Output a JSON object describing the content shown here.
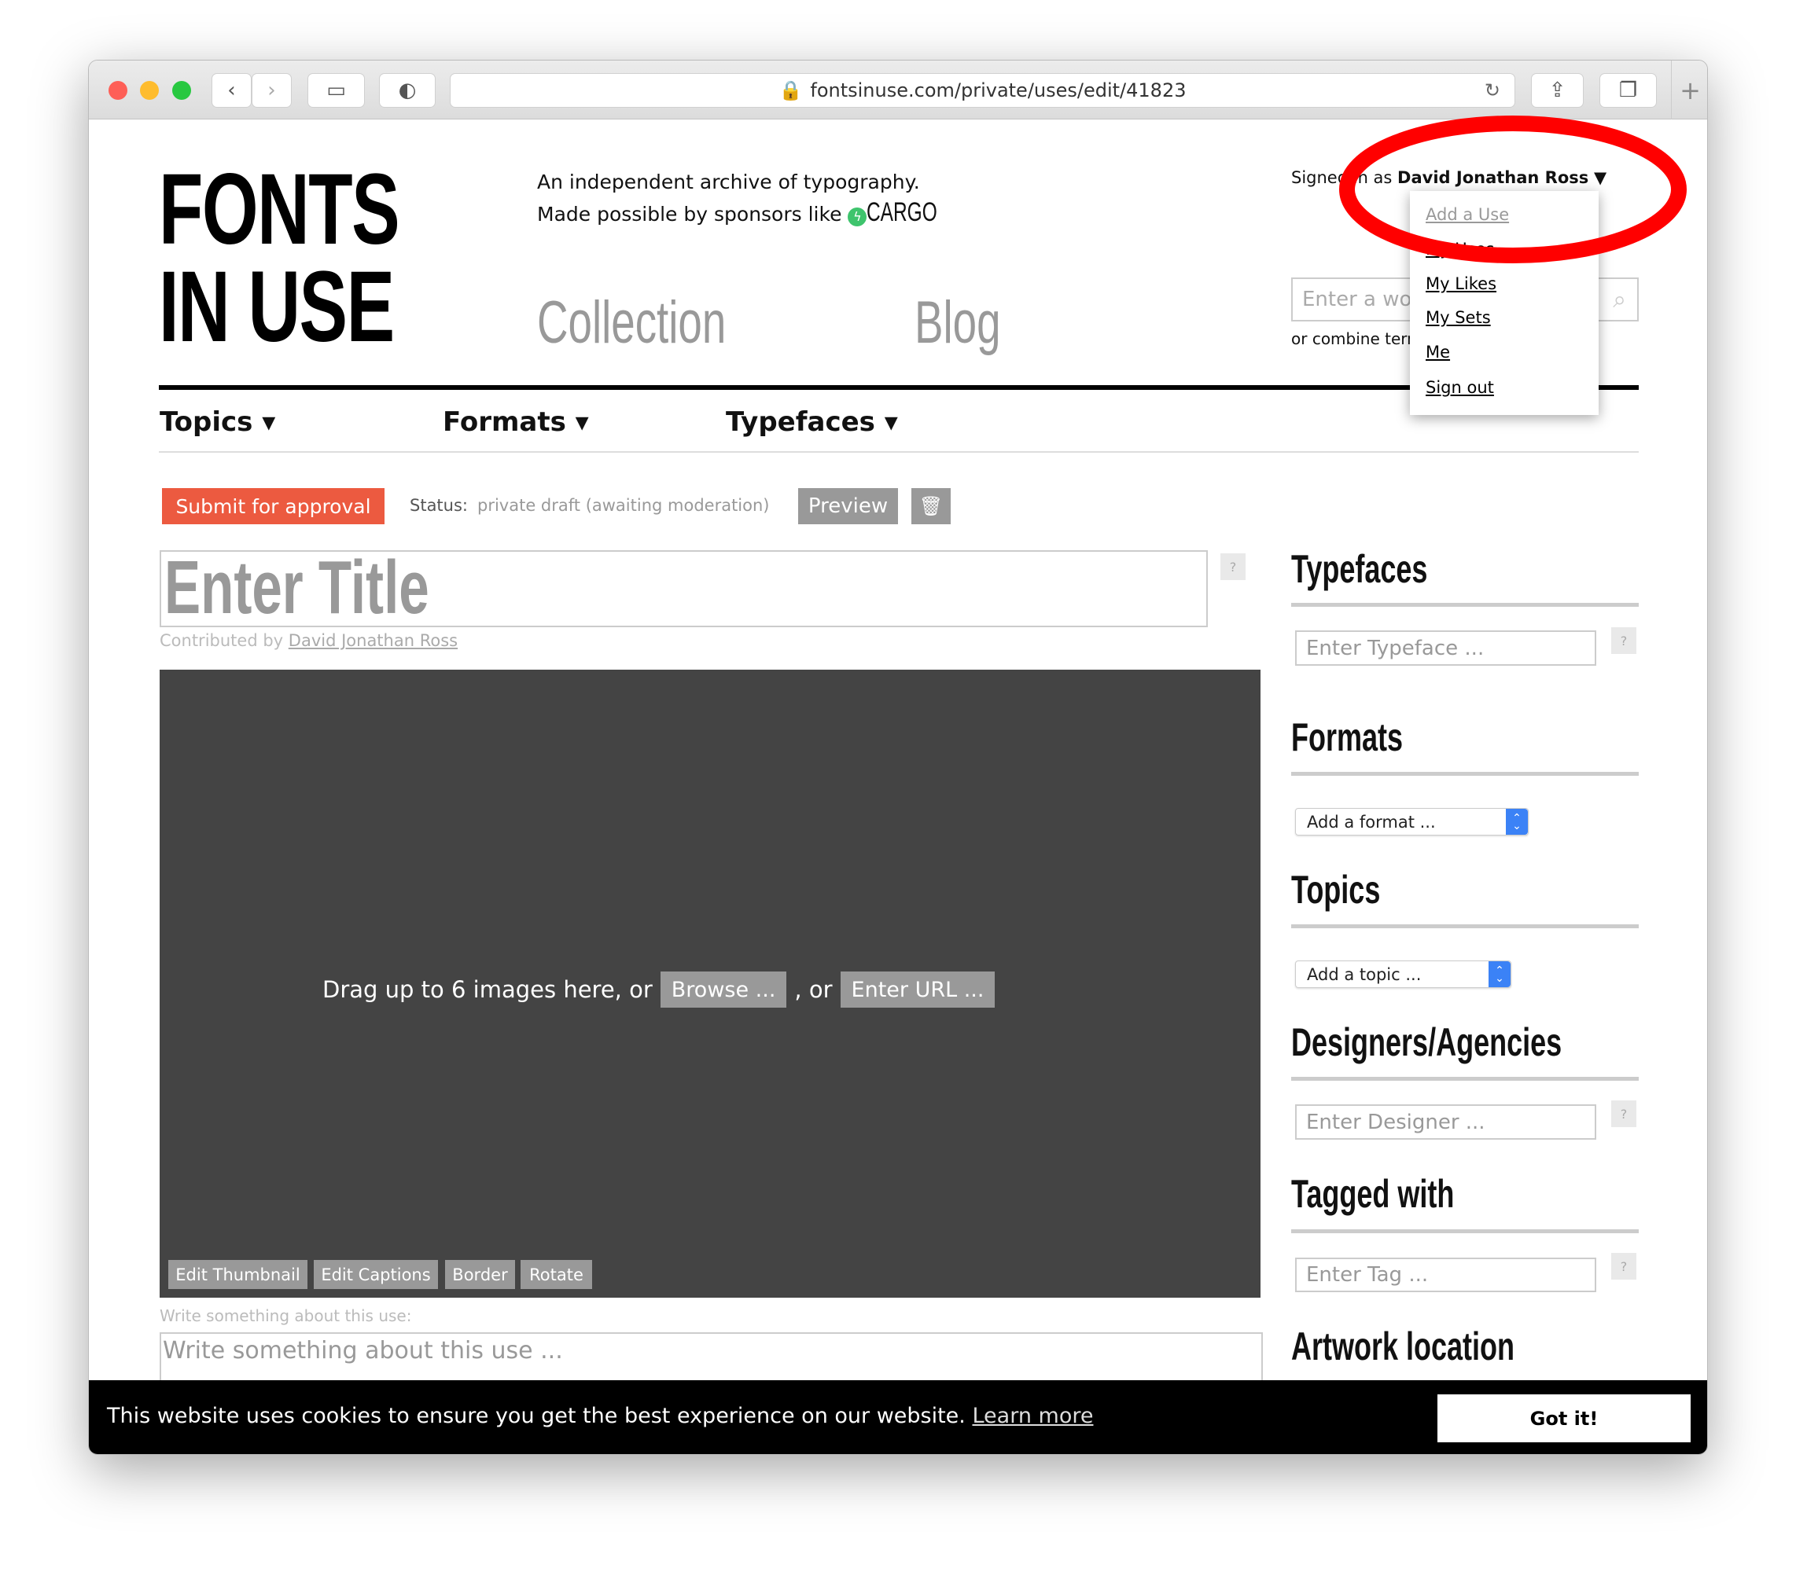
{
  "browser": {
    "url": "fontsinuse.com/private/uses/edit/41823"
  },
  "site": {
    "logo_line1": "FONTS",
    "logo_line2": "IN USE",
    "tagline1": "An independent archive of typography.",
    "tagline2": "Made possible by sponsors like",
    "sponsor": "CARGO",
    "main_nav": [
      "Collection",
      "Blog"
    ],
    "signed_in_prefix": "Signed in as",
    "user": "David Jonathan Ross",
    "search_placeholder": "Enter a word",
    "search_hint": "or combine terms",
    "nav": [
      "Topics ▾",
      "Formats ▾",
      "Typefaces ▾"
    ]
  },
  "user_menu": [
    "Add a Use",
    "My Uses",
    "My Likes",
    "My Sets",
    "Me",
    "Sign out"
  ],
  "editor": {
    "submit": "Submit for approval",
    "status_label": "Status:",
    "status_value": "private draft (awaiting moderation)",
    "preview": "Preview",
    "title_placeholder": "Enter Title",
    "help": "?",
    "contributed_by": "Contributed by",
    "contributor": "David Jonathan Ross",
    "drop_text": "Drag up to 6 images here, or",
    "browse": "Browse ...",
    "or": ", or",
    "enter_url": "Enter URL ...",
    "tools": [
      "Edit Thumbnail",
      "Edit Captions",
      "Border",
      "Rotate"
    ],
    "desc_label": "Write something about this use:",
    "desc_placeholder": "Write something about this use ..."
  },
  "sidebar": {
    "typefaces": "Typefaces",
    "typeface_placeholder": "Enter Typeface ...",
    "formats": "Formats",
    "format_select": "Add a format ...",
    "topics": "Topics",
    "topic_select": "Add a topic ...",
    "designers": "Designers/Agencies",
    "designer_placeholder": "Enter Designer ...",
    "tagged": "Tagged with",
    "tag_placeholder": "Enter Tag ...",
    "artwork": "Artwork location"
  },
  "cookie": {
    "text": "This website uses cookies to ensure you get the best experience on our website.",
    "learn": "Learn more",
    "ok": "Got it!"
  },
  "colors": {
    "submit": "#ec5a40",
    "annotation": "#ff0000",
    "dropzone": "#444444"
  }
}
